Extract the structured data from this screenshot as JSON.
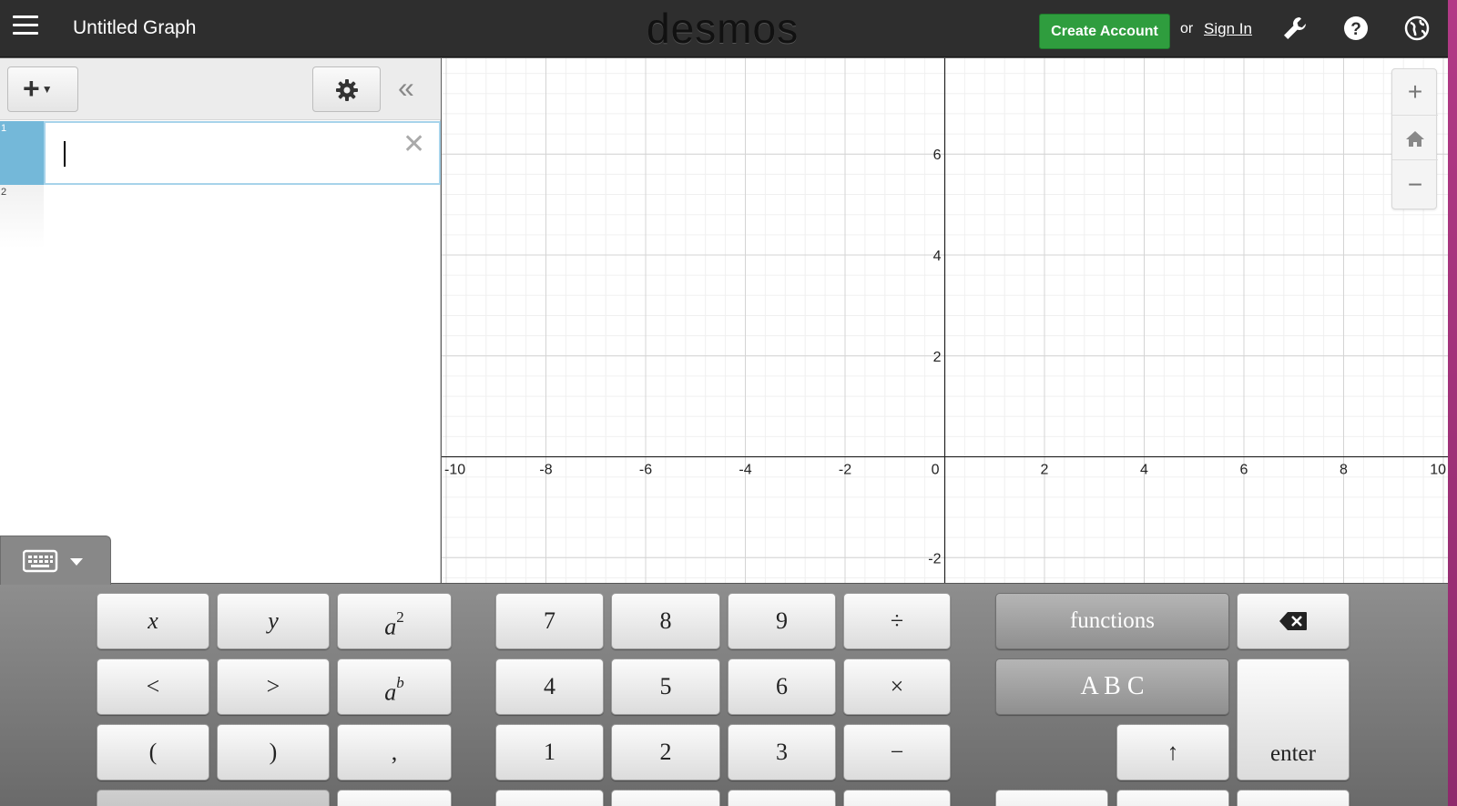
{
  "header": {
    "title": "Untitled Graph",
    "logo": "desmos",
    "create_account": "Create Account",
    "or": "or",
    "sign_in": "Sign In"
  },
  "expressions": {
    "rows": [
      {
        "number": "1",
        "value": ""
      },
      {
        "number": "2",
        "value": ""
      }
    ]
  },
  "graph": {
    "x_ticks": [
      "-10",
      "-8",
      "-6",
      "-4",
      "-2",
      "0",
      "2",
      "4",
      "6",
      "8",
      "10"
    ],
    "y_ticks": [
      "6",
      "4",
      "2",
      "-2"
    ],
    "x_range": [
      -10,
      10
    ],
    "y_range": [
      -2.5,
      7.9
    ],
    "grid": true
  },
  "keyboard": {
    "x": "x",
    "y": "y",
    "a": "a",
    "sq": "2",
    "b": "b",
    "lt": "<",
    "gt": ">",
    "lparen": "(",
    "rparen": ")",
    "comma": ",",
    "k7": "7",
    "k8": "8",
    "k9": "9",
    "div": "÷",
    "k4": "4",
    "k5": "5",
    "k6": "6",
    "mul": "×",
    "k1": "1",
    "k2": "2",
    "k3": "3",
    "minus": "−",
    "functions": "functions",
    "abc": "A B C",
    "up": "↑",
    "enter": "enter"
  },
  "colors": {
    "topbar": "#2e2e2e",
    "create_account": "#2f9d3e",
    "expression_tab": "#74b8d9"
  }
}
